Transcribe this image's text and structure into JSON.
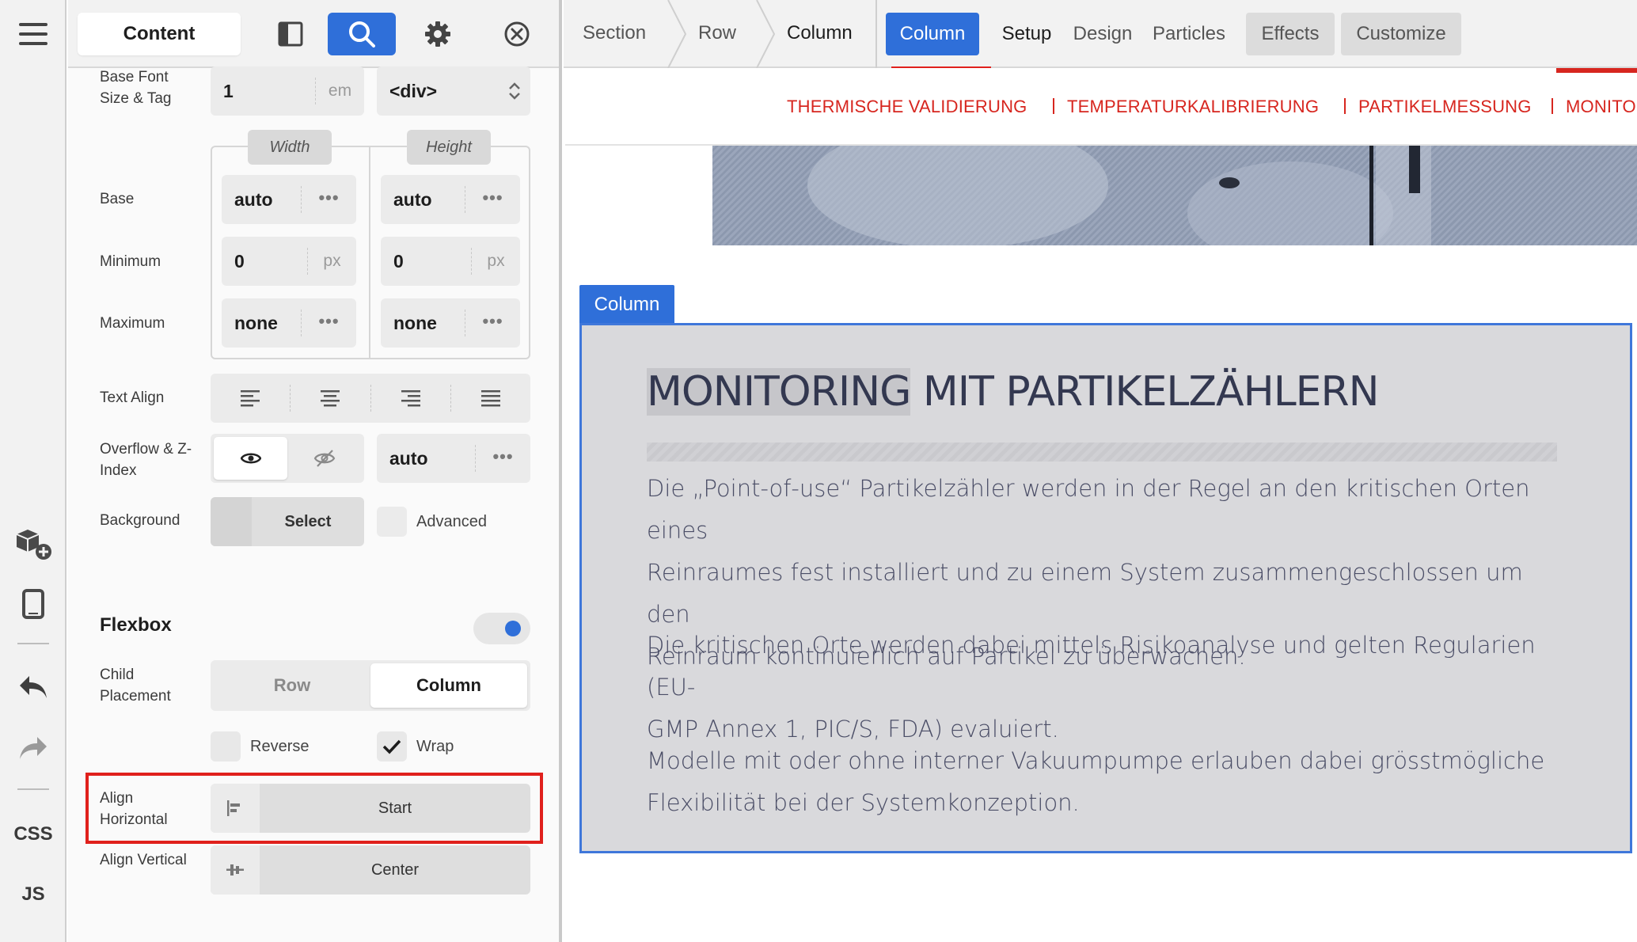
{
  "panel": {
    "mode_label": "Content",
    "base_font": {
      "label": "Base Font Size & Tag",
      "value": "1",
      "unit": "em",
      "tag": "<div>"
    },
    "dimensions": {
      "width_tab": "Width",
      "height_tab": "Height",
      "rows": [
        {
          "label": "Base",
          "width": "auto",
          "width_unit": "•••",
          "height": "auto",
          "height_unit": "•••"
        },
        {
          "label": "Minimum",
          "width": "0",
          "width_unit": "px",
          "height": "0",
          "height_unit": "px"
        },
        {
          "label": "Maximum",
          "width": "none",
          "width_unit": "•••",
          "height": "none",
          "height_unit": "•••"
        }
      ]
    },
    "text_align_label": "Text Align",
    "overflow": {
      "label": "Overflow & Z-Index",
      "z_value": "auto",
      "z_dots": "•••"
    },
    "background": {
      "label": "Background",
      "select_label": "Select",
      "advanced_label": "Advanced"
    },
    "flexbox": {
      "title": "Flexbox",
      "enabled": true,
      "child_placement_label": "Child Placement",
      "row_label": "Row",
      "column_label": "Column",
      "reverse_label": "Reverse",
      "wrap_label": "Wrap",
      "align_h_label": "Align Horizontal",
      "align_h_value": "Start",
      "align_v_label": "Align Vertical",
      "align_v_value": "Center"
    }
  },
  "rail": {
    "css_label": "CSS",
    "js_label": "JS"
  },
  "breadcrumb": {
    "items": [
      "Section",
      "Row",
      "Column"
    ]
  },
  "tabs": [
    "Column",
    "Setup",
    "Design",
    "Particles",
    "Effects",
    "Customize"
  ],
  "preview": {
    "nav": [
      "THERMISCHE VALIDIERUNG",
      "TEMPERATURKALIBRIERUNG",
      "PARTIKELMESSUNG",
      "MONITO"
    ],
    "column_tag": "Column",
    "heading_part1": "MONITORING",
    "heading_part2": " MIT PARTIKELZÄHLERN",
    "para1_line1": "Die „Point-of-use“ Partikelzähler werden in der Regel an den kritischen Orten eines",
    "para1_line2": "Reinraumes fest installiert und zu einem System zusammengeschlossen um den",
    "para1_line3": "Reinraum kontinuierlich auf Partikel zu überwachen.",
    "para2_line1": "Die kritischen Orte werden dabei mittels Risikoanalyse und gelten Regularien (EU-",
    "para2_line2": "GMP Annex 1, PIC/S, FDA) evaluiert.",
    "para3_line1": "Modelle mit oder ohne interner Vakuumpumpe erlauben dabei grösstmögliche",
    "para3_line2": "Flexibilität bei der Systemkonzeption."
  },
  "colors": {
    "accent_blue": "#2f6fd9",
    "nav_red": "#d7261f",
    "highlight_red": "#e0201c"
  }
}
